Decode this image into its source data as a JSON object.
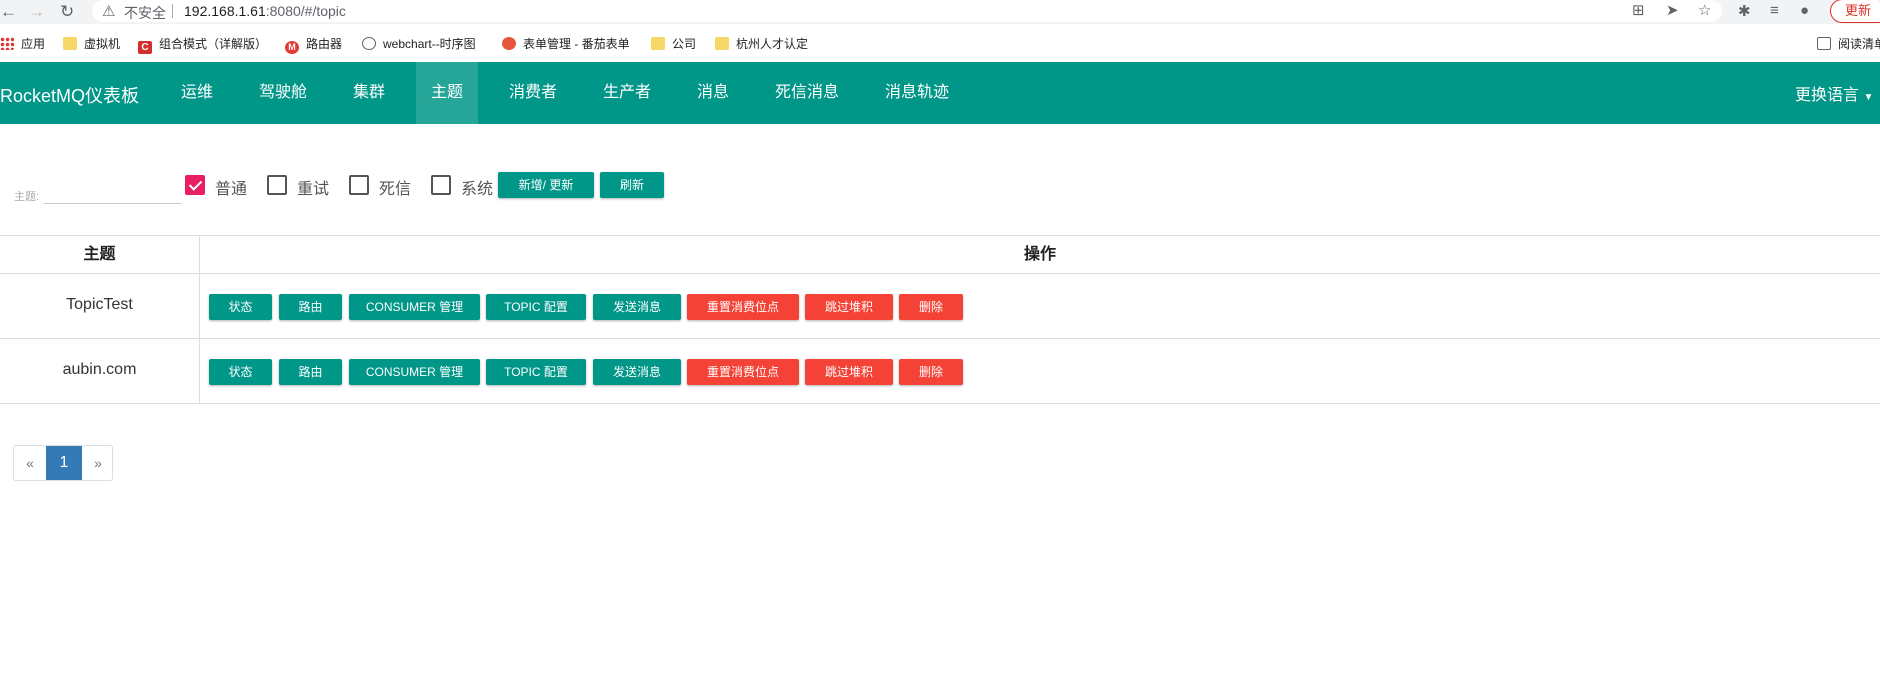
{
  "browser": {
    "insecure_label": "不安全",
    "url_host": "192.168.1.61",
    "url_rest": ":8080/#/topic",
    "update_label": "更新",
    "bookmarks": [
      {
        "label": "应用",
        "icon": "apps-icon"
      },
      {
        "label": "虚拟机",
        "icon": "folder-icon"
      },
      {
        "label": "组合模式（详解版）",
        "icon": "c-site-icon"
      },
      {
        "label": "路由器",
        "icon": "m-site-icon"
      },
      {
        "label": "webchart--时序图",
        "icon": "globe-icon"
      },
      {
        "label": "表单管理 - 番茄表单",
        "icon": "tomato-icon"
      },
      {
        "label": "公司",
        "icon": "folder-icon"
      },
      {
        "label": "杭州人才认定",
        "icon": "folder-icon"
      },
      {
        "label": "阅读清单",
        "icon": "reading-list-icon"
      }
    ]
  },
  "navbar": {
    "brand": "RocketMQ仪表板",
    "items": [
      {
        "label": "运维"
      },
      {
        "label": "驾驶舱"
      },
      {
        "label": "集群"
      },
      {
        "label": "主题"
      },
      {
        "label": "消费者"
      },
      {
        "label": "生产者"
      },
      {
        "label": "消息"
      },
      {
        "label": "死信消息"
      },
      {
        "label": "消息轨迹"
      }
    ],
    "active_index": 3,
    "language": "更换语言"
  },
  "filter": {
    "topic_label": "主题:",
    "topic_value": "",
    "checkboxes": [
      {
        "label": "普通",
        "checked": true
      },
      {
        "label": "重试",
        "checked": false
      },
      {
        "label": "死信",
        "checked": false
      },
      {
        "label": "系统",
        "checked": false
      }
    ],
    "add_update_label": "新增/ 更新",
    "refresh_label": "刷新"
  },
  "table": {
    "headers": [
      "主题",
      "操作"
    ],
    "actions": [
      "状态",
      "路由",
      "CONSUMER 管理",
      "TOPIC 配置",
      "发送消息",
      "重置消费位点",
      "跳过堆积",
      "删除"
    ],
    "rows": [
      {
        "topic": "TopicTest"
      },
      {
        "topic": "aubin.com"
      }
    ]
  },
  "pagination": {
    "prev": "«",
    "current": "1",
    "next": "»"
  },
  "colors": {
    "primary": "#009688",
    "danger": "#f44336",
    "checkbox": "#e91e63",
    "page_active": "#337ab7"
  }
}
